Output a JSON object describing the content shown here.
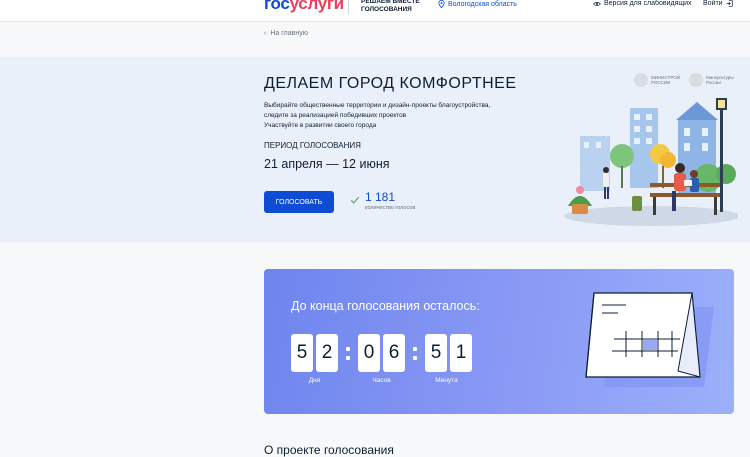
{
  "header": {
    "logo_part1": "гос",
    "logo_part2": "услуги",
    "tagline": "РЕШАЕМ ВМЕСТЕ\nГОЛОСОВАНИЯ",
    "region": "Вологодская область",
    "vision_mode": "Версия для слабовидящих",
    "login": "Войти"
  },
  "breadcrumb": {
    "back_label": "На главную"
  },
  "hero": {
    "title": "ДЕЛАЕМ ГОРОД КОМФОРТНЕЕ",
    "description": [
      "Выбирайте общественные территории и дизайн-проекты благоустройства,",
      "следите за реализацией победивших проектов",
      "Участвуйте в развитии своего города"
    ],
    "period_label": "ПЕРИОД ГОЛОСОВАНИЯ",
    "period_dates": "21 апреля — 12 июня",
    "vote_button": "ГОЛОСОВАТЬ",
    "votes_count": "1 181",
    "votes_label": "количество голосов",
    "ministries": [
      "МИНИСТРОЙ\nРОССИИ",
      "Минкультуры\nРоссии"
    ]
  },
  "timer": {
    "title": "До конца голосования осталось:",
    "days_digits": [
      "5",
      "2"
    ],
    "hours_digits": [
      "0",
      "6"
    ],
    "minutes_digits": [
      "5",
      "1"
    ],
    "days_label": "Дня",
    "hours_label": "Часов",
    "minutes_label": "Минута"
  },
  "about": {
    "title": "О проекте голосования"
  },
  "colors": {
    "brand_blue": "#0d4cd3",
    "brand_red": "#ee3f58",
    "hero_bg": "#eaf0f9",
    "timer_gradient_start": "#6e85ee",
    "timer_gradient_end": "#9bb0fb"
  },
  "icons": [
    "location-pin-icon",
    "eye-icon",
    "login-icon",
    "chevron-left-icon",
    "check-icon",
    "ministry-emblem-icon",
    "calendar-illustration"
  ]
}
